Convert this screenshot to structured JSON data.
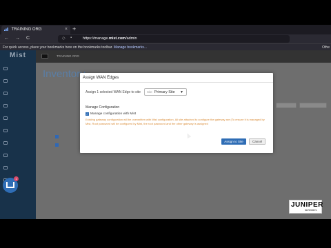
{
  "browser": {
    "tab_title": "TRAINING ORG",
    "new_tab": "+",
    "close": "×",
    "back": "←",
    "forward": "→",
    "reload": "C",
    "url_prefix": "https://manage.",
    "url_domain": "mist.com",
    "url_path": "/admin",
    "bookmarks_text": "For quick access, place your bookmarks here on the bookmarks toolbar.",
    "bookmarks_link": "Manage bookmarks...",
    "bookmarks_other": "Othe"
  },
  "app": {
    "brand": "Mist",
    "org_name": "TRAINING ORG",
    "page_title": "Inventory"
  },
  "modal": {
    "title": "Assign WAN Edges",
    "assign_text": "Assign 1 selected WAN Edge to site",
    "site_label": "Site",
    "site_value": "Primary Site",
    "section_title": "Manage Configuration",
    "checkbox_label": "Manage configuration with Mist",
    "warning": "Existing gateway configuration will be overwritten with Mist configuration. All site attached to configure the gateway are (To ensure it is managed by Mist, Root password will be configured by Mist, the root password and the other gateway is assigned",
    "primary_button": "Assign to Site",
    "cancel_button": "Cancel"
  },
  "help_badge": "1",
  "watermark": {
    "name": "JUNIPER",
    "sub": "NETWORKS"
  }
}
